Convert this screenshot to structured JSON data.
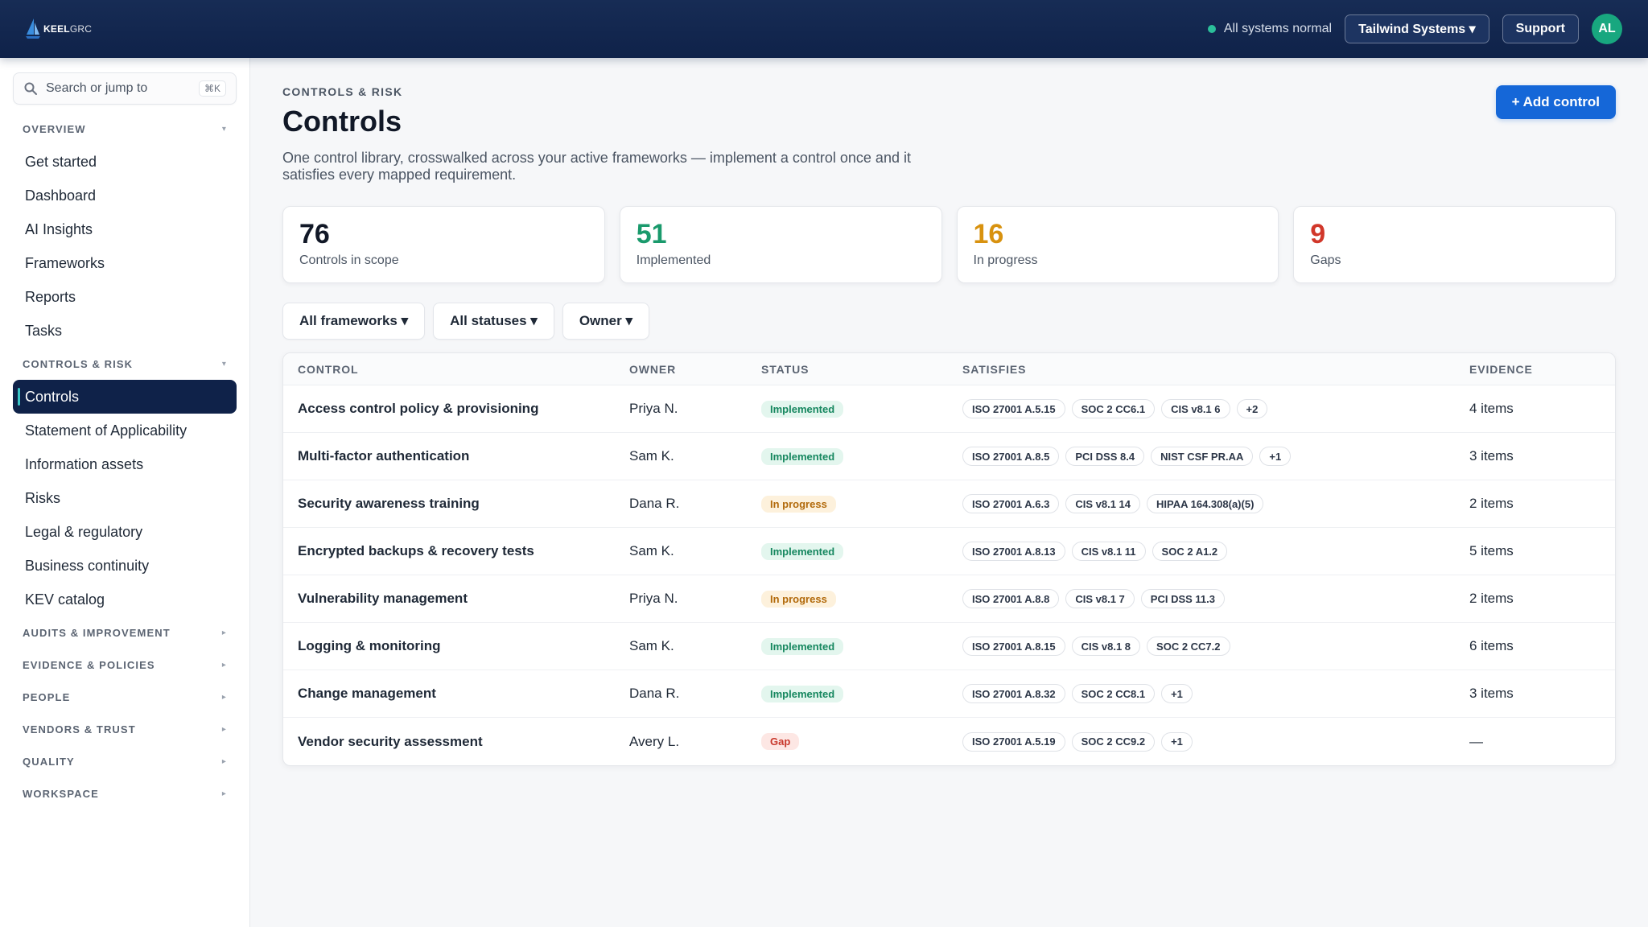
{
  "topbar": {
    "logo_brand": "KEEL",
    "logo_suffix": "GRC",
    "status_text": "All systems normal",
    "org_label": "Tailwind Systems ▾",
    "support_label": "Support",
    "avatar_initials": "AL"
  },
  "sidebar": {
    "search_placeholder": "Search or jump to",
    "search_shortcut": "⌘K",
    "sections": [
      {
        "title": "OVERVIEW",
        "expanded": true,
        "items": [
          "Get started",
          "Dashboard",
          "AI Insights",
          "Frameworks",
          "Reports",
          "Tasks"
        ]
      },
      {
        "title": "CONTROLS & RISK",
        "expanded": true,
        "items": [
          "Controls",
          "Statement of Applicability",
          "Information assets",
          "Risks",
          "Legal & regulatory",
          "Business continuity",
          "KEV catalog"
        ]
      },
      {
        "title": "AUDITS & IMPROVEMENT",
        "expanded": false
      },
      {
        "title": "EVIDENCE & POLICIES",
        "expanded": false
      },
      {
        "title": "PEOPLE",
        "expanded": false
      },
      {
        "title": "VENDORS & TRUST",
        "expanded": false
      },
      {
        "title": "QUALITY",
        "expanded": false
      },
      {
        "title": "WORKSPACE",
        "expanded": false
      }
    ],
    "active_item": "Controls",
    "caret_expanded": "▾",
    "caret_collapsed": "▸"
  },
  "main": {
    "breadcrumb": "CONTROLS & RISK",
    "title": "Controls",
    "description": "One control library, crosswalked across your active frameworks — implement a control once and it satisfies every mapped requirement.",
    "add_button": "+ Add control",
    "stats": [
      {
        "value": "76",
        "label": "Controls in scope",
        "color": "#111827"
      },
      {
        "value": "51",
        "label": "Implemented",
        "color": "#1a9a6c"
      },
      {
        "value": "16",
        "label": "In progress",
        "color": "#d8920f"
      },
      {
        "value": "9",
        "label": "Gaps",
        "color": "#d1372a"
      }
    ],
    "filters": [
      "All frameworks ▾",
      "All statuses ▾",
      "Owner ▾"
    ],
    "table": {
      "headers": [
        "CONTROL",
        "OWNER",
        "STATUS",
        "SATISFIES",
        "EVIDENCE"
      ],
      "rows": [
        {
          "control": "Access control policy & provisioning",
          "owner": "Priya N.",
          "status": "Implemented",
          "status_kind": "implemented",
          "satisfies": [
            "ISO 27001 A.5.15",
            "SOC 2 CC6.1",
            "CIS v8.1 6",
            "+2"
          ],
          "evidence": "4 items"
        },
        {
          "control": "Multi-factor authentication",
          "owner": "Sam K.",
          "status": "Implemented",
          "status_kind": "implemented",
          "satisfies": [
            "ISO 27001 A.8.5",
            "PCI DSS 8.4",
            "NIST CSF PR.AA",
            "+1"
          ],
          "evidence": "3 items"
        },
        {
          "control": "Security awareness training",
          "owner": "Dana R.",
          "status": "In progress",
          "status_kind": "progress",
          "satisfies": [
            "ISO 27001 A.6.3",
            "CIS v8.1 14",
            "HIPAA 164.308(a)(5)"
          ],
          "evidence": "2 items"
        },
        {
          "control": "Encrypted backups & recovery tests",
          "owner": "Sam K.",
          "status": "Implemented",
          "status_kind": "implemented",
          "satisfies": [
            "ISO 27001 A.8.13",
            "CIS v8.1 11",
            "SOC 2 A1.2"
          ],
          "evidence": "5 items"
        },
        {
          "control": "Vulnerability management",
          "owner": "Priya N.",
          "status": "In progress",
          "status_kind": "progress",
          "satisfies": [
            "ISO 27001 A.8.8",
            "CIS v8.1 7",
            "PCI DSS 11.3"
          ],
          "evidence": "2 items"
        },
        {
          "control": "Logging & monitoring",
          "owner": "Sam K.",
          "status": "Implemented",
          "status_kind": "implemented",
          "satisfies": [
            "ISO 27001 A.8.15",
            "CIS v8.1 8",
            "SOC 2 CC7.2"
          ],
          "evidence": "6 items"
        },
        {
          "control": "Change management",
          "owner": "Dana R.",
          "status": "Implemented",
          "status_kind": "implemented",
          "satisfies": [
            "ISO 27001 A.8.32",
            "SOC 2 CC8.1",
            "+1"
          ],
          "evidence": "3 items"
        },
        {
          "control": "Vendor security assessment",
          "owner": "Avery L.",
          "status": "Gap",
          "status_kind": "gap",
          "satisfies": [
            "ISO 27001 A.5.19",
            "SOC 2 CC9.2",
            "+1"
          ],
          "evidence": "—"
        }
      ]
    }
  }
}
